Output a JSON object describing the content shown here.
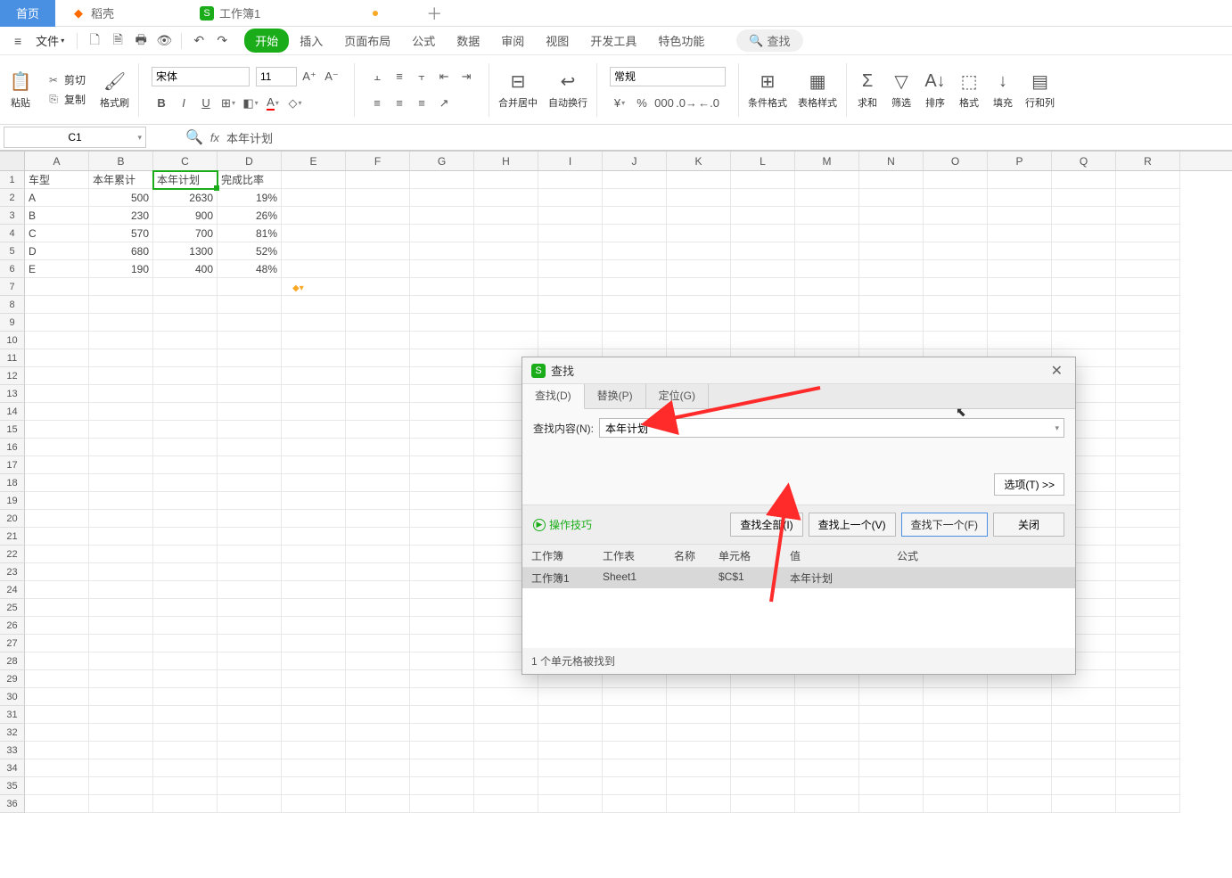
{
  "app_tabs": {
    "home": "首页",
    "daoke": "稻壳",
    "workbook": "工作簿1"
  },
  "menubar": {
    "file": "文件",
    "tabs": [
      "开始",
      "插入",
      "页面布局",
      "公式",
      "数据",
      "审阅",
      "视图",
      "开发工具",
      "特色功能"
    ],
    "search": "查找"
  },
  "ribbon": {
    "paste": "粘贴",
    "cut": "剪切",
    "copy": "复制",
    "format_painter": "格式刷",
    "font_name": "宋体",
    "font_size": "11",
    "merge_center": "合并居中",
    "wrap_text": "自动换行",
    "number_format": "常规",
    "cond_fmt": "条件格式",
    "table_style": "表格样式",
    "sum": "求和",
    "filter": "筛选",
    "sort": "排序",
    "format": "格式",
    "fill": "填充",
    "rowcol": "行和列"
  },
  "name_box": "C1",
  "formula_value": "本年计划",
  "columns": [
    "A",
    "B",
    "C",
    "D",
    "E",
    "F",
    "G",
    "H",
    "I",
    "J",
    "K",
    "L",
    "M",
    "N",
    "O",
    "P",
    "Q",
    "R"
  ],
  "sheet_data": {
    "headers": [
      "车型",
      "本年累计",
      "本年计划",
      "完成比率"
    ],
    "rows": [
      {
        "a": "A",
        "b": "500",
        "c": "2630",
        "d": "19%"
      },
      {
        "a": "B",
        "b": "230",
        "c": "900",
        "d": "26%"
      },
      {
        "a": "C",
        "b": "570",
        "c": "700",
        "d": "81%"
      },
      {
        "a": "D",
        "b": "680",
        "c": "1300",
        "d": "52%"
      },
      {
        "a": "E",
        "b": "190",
        "c": "400",
        "d": "48%"
      }
    ]
  },
  "find": {
    "title": "查找",
    "tab_find": "查找(D)",
    "tab_replace": "替换(P)",
    "tab_goto": "定位(G)",
    "label_content": "查找内容(N):",
    "value": "本年计划",
    "options_btn": "选项(T) >>",
    "tips": "操作技巧",
    "find_all": "查找全部(I)",
    "find_prev": "查找上一个(V)",
    "find_next": "查找下一个(F)",
    "close": "关闭",
    "cols": {
      "wb": "工作簿",
      "ws": "工作表",
      "nm": "名称",
      "cell": "单元格",
      "val": "值",
      "fx": "公式"
    },
    "result": {
      "wb": "工作簿1",
      "ws": "Sheet1",
      "nm": "",
      "cell": "$C$1",
      "val": "本年计划",
      "fx": ""
    },
    "status": "1 个单元格被找到"
  }
}
